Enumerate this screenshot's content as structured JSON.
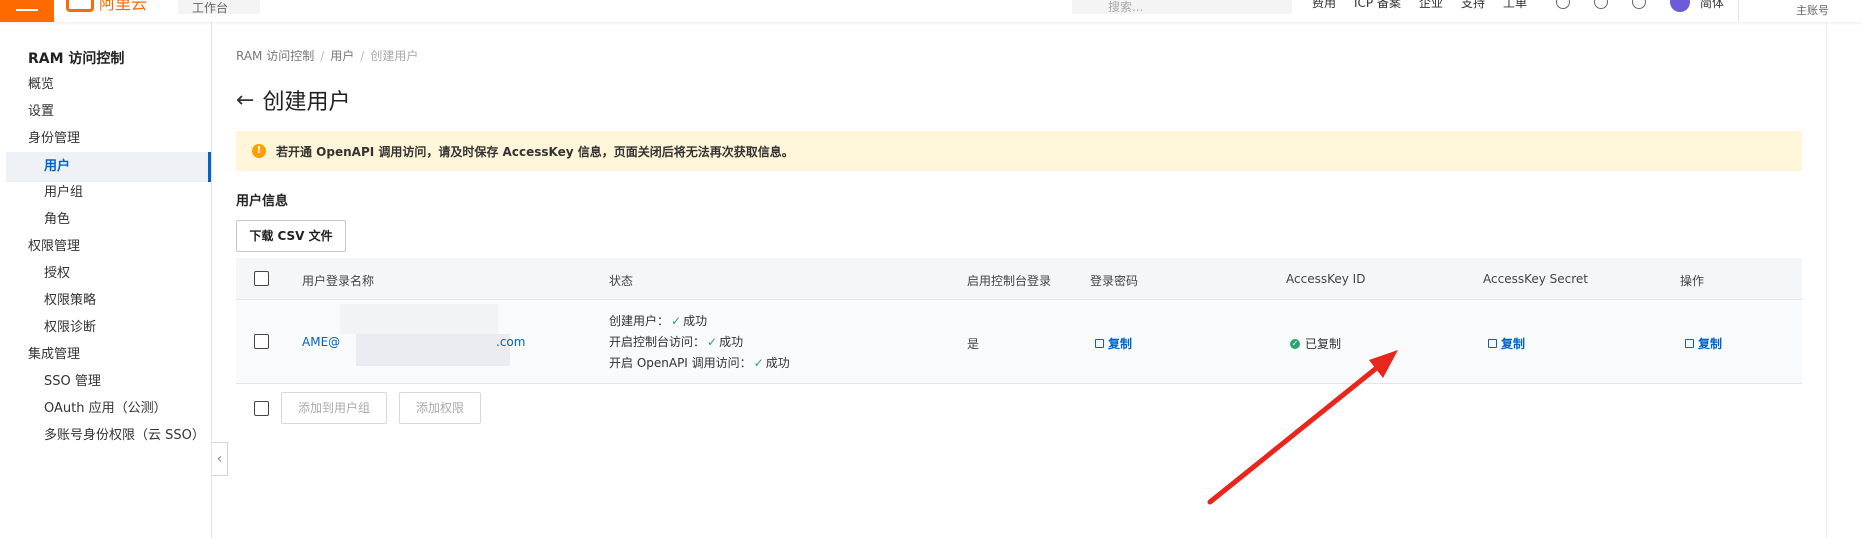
{
  "topbar": {
    "logo_text": "阿里云",
    "workbench_label": "工作台",
    "search_placeholder": "搜索...",
    "nav_items": [
      "费用",
      "ICP 备案",
      "企业",
      "支持",
      "工单"
    ],
    "lang_label": "简体",
    "account_label": "主账号",
    "brand_color": "#ff6a00"
  },
  "sidebar": {
    "title": "RAM 访问控制",
    "items": [
      {
        "label": "概览"
      },
      {
        "label": "设置"
      },
      {
        "label": "身份管理"
      },
      {
        "label": "用户"
      },
      {
        "label": "用户组"
      },
      {
        "label": "角色"
      },
      {
        "label": "权限管理"
      },
      {
        "label": "授权"
      },
      {
        "label": "权限策略"
      },
      {
        "label": "权限诊断"
      },
      {
        "label": "集成管理"
      },
      {
        "label": "SSO 管理"
      },
      {
        "label": "OAuth 应用（公测）"
      },
      {
        "label": "多账号身份权限（云 SSO）"
      }
    ]
  },
  "breadcrumb": [
    "RAM 访问控制",
    "用户",
    "创建用户"
  ],
  "page": {
    "title": "创建用户",
    "alert": "若开通 OpenAPI 调用访问，请及时保存 AccessKey 信息，页面关闭后将无法再次获取信息。",
    "section_title": "用户信息",
    "download_button": "下载 CSV 文件"
  },
  "table": {
    "headers": [
      "用户登录名称",
      "状态",
      "启用控制台登录",
      "登录密码",
      "AccessKey ID",
      "AccessKey Secret",
      "操作"
    ],
    "row": {
      "login_name_prefix": "AME@",
      "login_name_suffix": ".com",
      "status_lines": [
        {
          "label": "创建用户：",
          "result": "成功"
        },
        {
          "label": "开启控制台访问：",
          "result": "成功"
        },
        {
          "label": "开启 OpenAPI 调用访问：",
          "result": "成功"
        }
      ],
      "console_login": "是",
      "password_action": "复制",
      "accesskey_id_status": "已复制",
      "accesskey_secret_action": "复制",
      "operation_action": "复制"
    }
  },
  "footer_buttons": [
    "添加到用户组",
    "添加权限"
  ],
  "colors": {
    "link": "#0064c8",
    "success": "#2ba471",
    "alert_bg": "#fff5d9",
    "annotation_arrow": "#e8261c"
  }
}
